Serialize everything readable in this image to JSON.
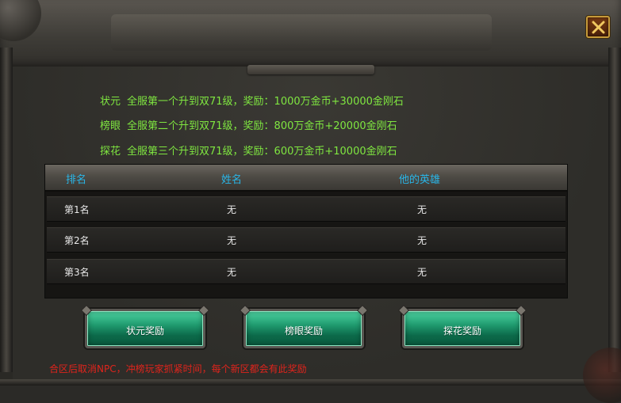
{
  "rewards": [
    {
      "rank": "状元",
      "desc": "全服第一个升到双71级，奖励：1000万金币+30000金刚石"
    },
    {
      "rank": "榜眼",
      "desc": "全服第二个升到双71级，奖励：800万金币+20000金刚石"
    },
    {
      "rank": "探花",
      "desc": "全服第三个升到双71级，奖励：600万金币+10000金刚石"
    }
  ],
  "table": {
    "headers": [
      "排名",
      "姓名",
      "他的英雄"
    ],
    "rows": [
      [
        "第1名",
        "无",
        "无"
      ],
      [
        "第2名",
        "无",
        "无"
      ],
      [
        "第3名",
        "无",
        "无"
      ]
    ]
  },
  "buttons": {
    "zhuangyuan": "状元奖励",
    "bangyan": "榜眼奖励",
    "tanhua": "探花奖励"
  },
  "footer_note": "合区后取消NPC，冲榜玩家抓紧时间，每个新区都会有此奖励",
  "colors": {
    "reward_text": "#7fe640",
    "header_text": "#29b6e8",
    "note_text": "#e0241c",
    "button_green": "#1f9a6e"
  },
  "icons": {
    "close": "close-x-icon"
  }
}
